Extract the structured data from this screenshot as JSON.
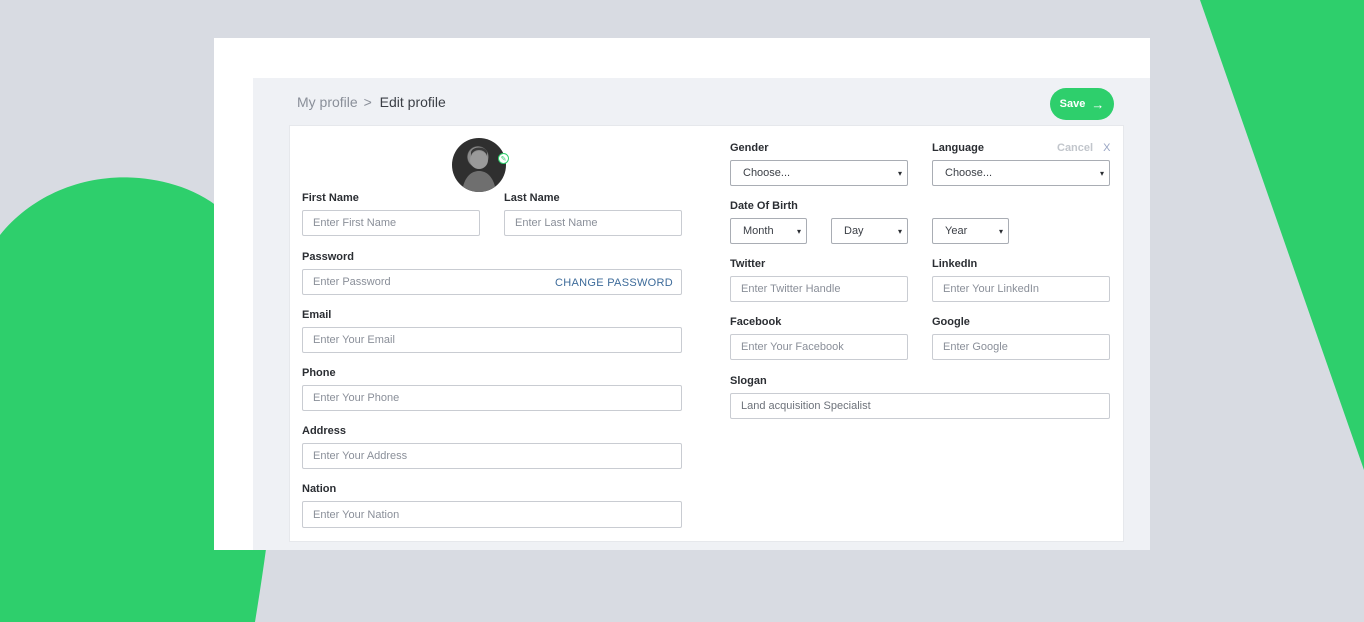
{
  "breadcrumb": {
    "parent": "My profile",
    "separator": ">",
    "current": "Edit profile"
  },
  "actions": {
    "save_label": "Save",
    "save_icon": "→",
    "cancel_label": "Cancel",
    "cancel_icon": "X"
  },
  "fields": {
    "first_name": {
      "label": "First Name",
      "placeholder": "Enter First Name"
    },
    "last_name": {
      "label": "Last Name",
      "placeholder": "Enter Last Name"
    },
    "password": {
      "label": "Password",
      "placeholder": "Enter Password",
      "change_label": "CHANGE PASSWORD"
    },
    "email": {
      "label": "Email",
      "placeholder": "Enter Your Email"
    },
    "phone": {
      "label": "Phone",
      "placeholder": "Enter Your Phone"
    },
    "address": {
      "label": "Address",
      "placeholder": "Enter Your Address"
    },
    "nation": {
      "label": "Nation",
      "placeholder": "Enter Your Nation"
    },
    "gender": {
      "label": "Gender",
      "value": "Choose..."
    },
    "language": {
      "label": "Language",
      "value": "Choose..."
    },
    "dob": {
      "label": "Date Of Birth",
      "month": "Month",
      "day": "Day",
      "year": "Year"
    },
    "twitter": {
      "label": "Twitter",
      "placeholder": "Enter Twitter Handle"
    },
    "linkedin": {
      "label": "LinkedIn",
      "placeholder": "Enter Your LinkedIn"
    },
    "facebook": {
      "label": "Facebook",
      "placeholder": "Enter Your Facebook"
    },
    "google": {
      "label": "Google",
      "placeholder": "Enter Google"
    },
    "slogan": {
      "label": "Slogan",
      "value": "Land acquisition Specialist"
    }
  },
  "icons": {
    "caret": "▾",
    "avatar_edit": "✎"
  },
  "colors": {
    "accent": "#2ecf6c",
    "background": "#d8dbe2",
    "link": "#3d6b9a"
  }
}
